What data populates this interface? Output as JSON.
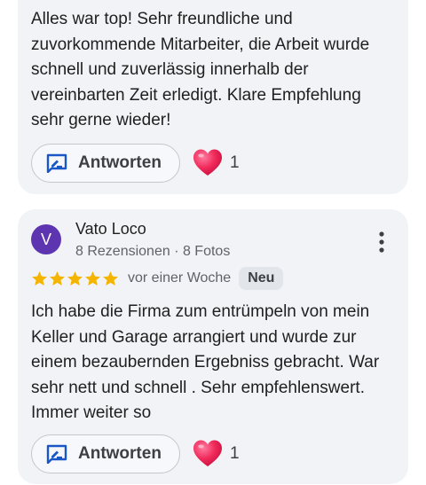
{
  "reviews": [
    {
      "text": "Alles war top! Sehr freundliche und\nzuvorkommende Mitarbeiter, die Arbeit wurde\nschnell und zuverlässig innerhalb der\nvereinbarten Zeit erledigt. Klare Empfehlung\nsehr gerne wieder!",
      "reply_label": "Antworten",
      "like_count": "1",
      "icons": {
        "reply": "reply-icon",
        "like": "heart-icon"
      }
    },
    {
      "author": {
        "initial": "V",
        "name": "Vato Loco",
        "meta": "8 Rezensionen · 8 Fotos",
        "avatar_color": "#5e35b1"
      },
      "rating": 5,
      "date": "vor einer Woche",
      "badge": "Neu",
      "text": "Ich habe die Firma zum entrümpeln von mein\nKeller und Garage arrangiert und wurde zur\neinem bezaubernden Ergebniss gebracht. War\nsehr nett und schnell . Sehr empfehlenswert.\nImmer weiter so",
      "reply_label": "Antworten",
      "like_count": "1",
      "icons": {
        "reply": "reply-icon",
        "like": "heart-icon",
        "more": "more-vert-icon",
        "star": "star-icon"
      }
    }
  ],
  "colors": {
    "card_bg": "#f1f3f7",
    "star": "#f4b400",
    "reply_icon": "#1a57c6",
    "heart": "#e91e63"
  }
}
